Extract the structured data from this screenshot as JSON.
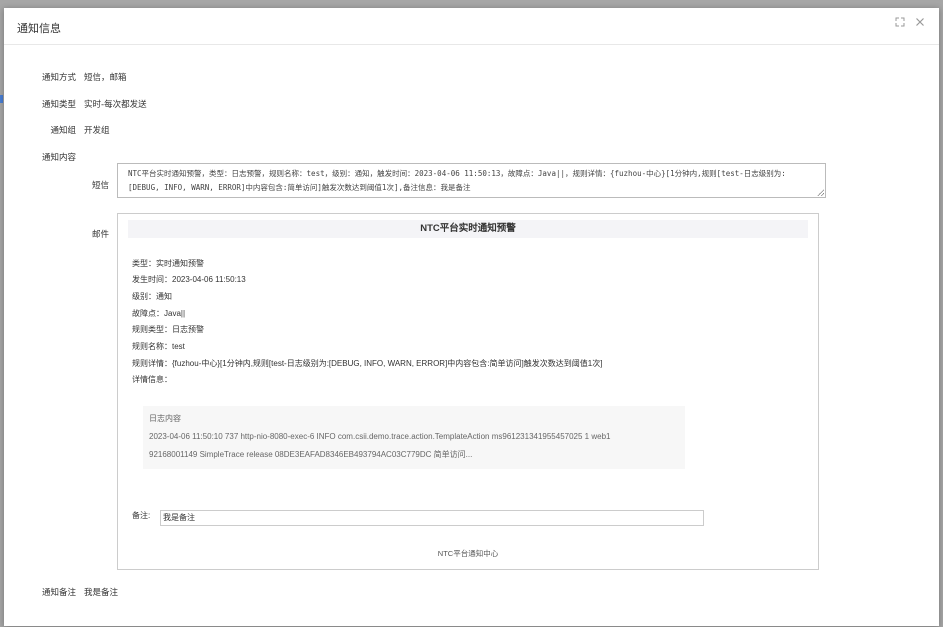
{
  "dialog": {
    "title": "通知信息"
  },
  "fields": {
    "notify_method_label": "通知方式",
    "notify_method_value": "短信，邮箱",
    "notify_type_label": "通知类型",
    "notify_type_value": "实时-每次都发送",
    "notify_group_label": "通知组",
    "notify_group_value": "开发组",
    "notify_content_label": "通知内容",
    "sms_label": "短信",
    "sms_text": "NTC平台实时通知预警，类型：日志预警，规则名称：test，级别：通知，触发时间：2023-04-06 11:50:13，故障点：Java||，规则详情：{fuzhou-中心}[1分钟内,规则[test-日志级别为:[DEBUG, INFO, WARN, ERROR]中内容包含:简单访问]触发次数达到阈值1次],备注信息：我是备注",
    "mail_label": "邮件",
    "notify_remark_label": "通知备注",
    "notify_remark_value": "我是备注"
  },
  "mail": {
    "title": "NTC平台实时通知预警",
    "type_label": "类型：",
    "type_value": "实时通知预警",
    "time_label": "发生时间：",
    "time_value": "2023-04-06 11:50:13",
    "level_label": "级别：",
    "level_value": "通知",
    "fault_label": "故障点：",
    "fault_value": "Java||",
    "rule_type_label": "规则类型：",
    "rule_type_value": "日志预警",
    "rule_name_label": "规则名称：",
    "rule_name_value": "test",
    "rule_detail_label": "规则详情：",
    "rule_detail_value": "{fuzhou-中心}[1分钟内,规则[test-日志级别为:[DEBUG, INFO, WARN, ERROR]中内容包含:简单访问]触发次数达到阈值1次]",
    "detail_label": "详情信息：",
    "log_title": "日志内容",
    "log_line1": "2023-04-06 11:50:10 737 http-nio-8080-exec-6 INFO com.csii.demo.trace.action.TemplateAction ms961231341955457025 1 web1",
    "log_line2": "92168001149 SimpleTrace release 08DE3EAFAD8346EB493794AC03C779DC 简单访问...",
    "remark_label": "备注:",
    "remark_value": "我是备注",
    "footer": "NTC平台通知中心"
  },
  "icons": {
    "maximize": "maximize-icon",
    "close": "close-icon"
  }
}
